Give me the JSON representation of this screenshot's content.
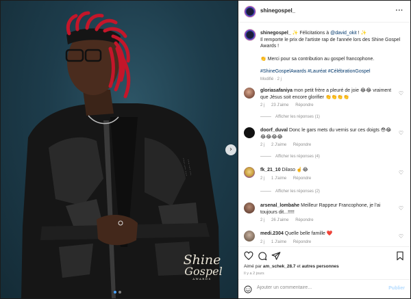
{
  "post": {
    "username": "shinegospel_",
    "more_icon": "more-horizontal-icon",
    "nav_next_icon": "chevron-right-icon"
  },
  "photo": {
    "logo_line1": "Shine",
    "logo_line2": "Gospel",
    "logo_line3": "AWARDS",
    "carousel_count": 2,
    "carousel_active": 1
  },
  "caption": {
    "username": "shinegospel_",
    "line1_prefix": " ✨ Félicitations à ",
    "line1_mention": "@david_okit",
    "line1_suffix": " ! ✨",
    "line2": "Il remporte le prix de l'artiste rap de l'année lors des Shine Gospel Awards !",
    "line3": "👏 Merci pour sa contribution au gospel francophone.",
    "hashtags": "#ShineGospelAwards #Lauréat #CélébrationGospel",
    "modified": "Modifié · 2 j"
  },
  "comments": [
    {
      "username": "gloriasafaniya",
      "text": " mon petit frère a pleuré de joie 😂😂 vraiment que Jésus soit encore glorifier 👏👏👏👏",
      "time": "2 j",
      "likes": "23 J'aime",
      "reply": "Répondre",
      "replies_label": "Afficher les réponses (1)"
    },
    {
      "username": "doorf_duval",
      "text": " Donc le gars mets du vernis sur ces doigts 😳😂😂😂😂😂",
      "time": "2 j",
      "likes": "2 J'aime",
      "reply": "Répondre",
      "replies_label": "Afficher les réponses (4)"
    },
    {
      "username": "fk_21_10",
      "text": " Dilaso ☝️😂",
      "time": "2 j",
      "likes": "1 J'aime",
      "reply": "Répondre",
      "replies_label": "Afficher les réponses (2)"
    },
    {
      "username": "arsenal_lombahe",
      "text": " Meilleur Rappeur Francophone, je l'ai toujours dit...!!!!!",
      "time": "2 j",
      "likes": "26 J'aime",
      "reply": "Répondre",
      "replies_label": ""
    },
    {
      "username": "medi.2304",
      "text": " Quelle belle famille ❤️",
      "time": "2 j",
      "likes": "1 J'aime",
      "reply": "Répondre",
      "replies_label": ""
    }
  ],
  "actions": {
    "liked_by_prefix": "Aimé par ",
    "liked_by_user": "am_schek_28.7",
    "liked_by_suffix": " et ",
    "liked_by_others": "autres personnes",
    "time_ago": "Il y a 2 jours"
  },
  "add_comment": {
    "placeholder": "Ajouter un commentaire...",
    "publish_label": "Publier"
  },
  "colors": {
    "link": "#00376b",
    "muted": "#8e8e8e",
    "publish_disabled": "#b3dbff",
    "carousel_active": "#4aa3ff"
  }
}
